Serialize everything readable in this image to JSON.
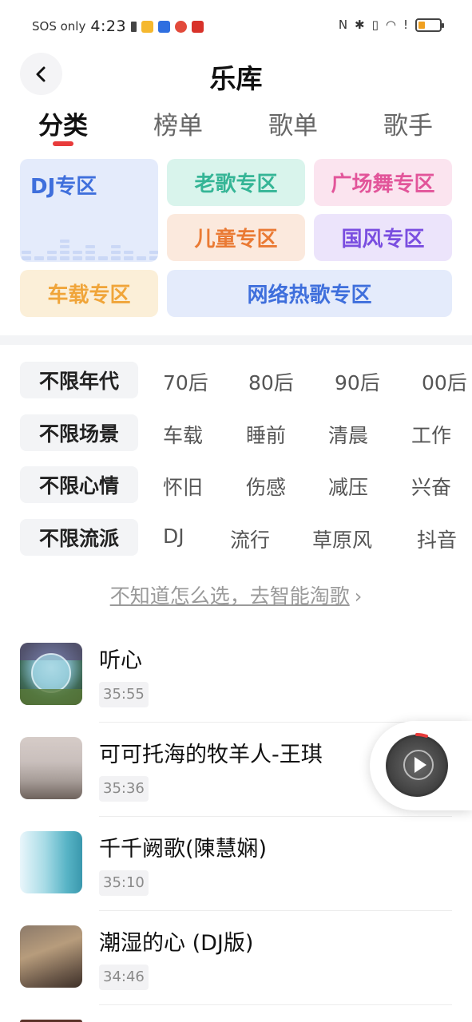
{
  "status_bar": {
    "sos": "SOS only",
    "time": "4:23",
    "battery_level": 0.3
  },
  "header": {
    "title": "乐库",
    "back_icon": "chevron-left-icon"
  },
  "tabs": [
    {
      "label": "分类",
      "active": true
    },
    {
      "label": "榜单",
      "active": false
    },
    {
      "label": "歌单",
      "active": false
    },
    {
      "label": "歌手",
      "active": false
    }
  ],
  "categories": {
    "dj": "DJ专区",
    "laoge": "老歌专区",
    "guangchang": "广场舞专区",
    "ertong": "儿童专区",
    "guofeng": "国风专区",
    "chezai": "车载专区",
    "wangluo": "网络热歌专区"
  },
  "filters": [
    {
      "selected": "不限年代",
      "options": [
        "70后",
        "80后",
        "90后",
        "00后"
      ]
    },
    {
      "selected": "不限场景",
      "options": [
        "车载",
        "睡前",
        "清晨",
        "工作"
      ]
    },
    {
      "selected": "不限心情",
      "options": [
        "怀旧",
        "伤感",
        "减压",
        "兴奋"
      ]
    },
    {
      "selected": "不限流派",
      "options": [
        "DJ",
        "流行",
        "草原风",
        "抖音"
      ]
    }
  ],
  "smart_pick": {
    "label": "不知道怎么选，去智能淘歌",
    "chevron": "›"
  },
  "songs": [
    {
      "title": "听心",
      "duration": "35:55"
    },
    {
      "title": "可可托海的牧羊人-王琪",
      "duration": "35:36"
    },
    {
      "title": "千千阙歌(陳慧娴)",
      "duration": "35:10"
    },
    {
      "title": "潮湿的心 (DJ版)",
      "duration": "34:46"
    }
  ],
  "colors": {
    "accent_red": "#e83b3b",
    "dj_blue": "#3f6fdc",
    "laoge_green": "#35b596",
    "guangchang_pink": "#e2559a",
    "ertong_orange": "#ea7a34",
    "guofeng_purple": "#7a4ee0",
    "chezai_yellow": "#f0a53a"
  },
  "mini_player": {
    "state": "paused",
    "icon": "play-icon"
  }
}
